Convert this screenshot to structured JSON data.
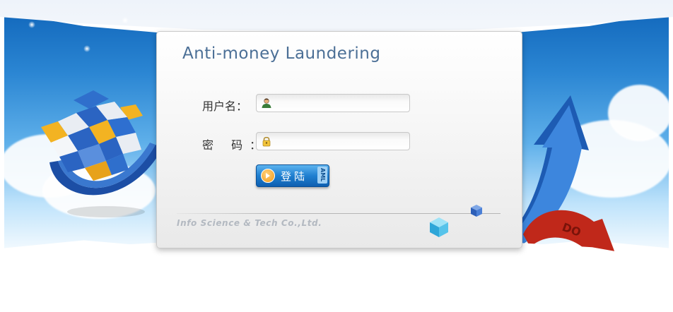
{
  "panel": {
    "title": "Anti-money Laundering",
    "username_label": "用户名",
    "password_label": "密 码",
    "colon": "：",
    "username_value": "",
    "password_value": "",
    "login_button_label": "登陆",
    "login_button_tag": "AML",
    "company": "Info Science & Tech Co.,Ltd."
  },
  "icons": {
    "user_field": "user-icon",
    "password_field": "lock-icon",
    "login": "arrow-right-icon"
  },
  "decoration": {
    "arrow_text": "DO"
  },
  "colors": {
    "title": "#4b6f96",
    "button": "#1f7fd0",
    "arrow_blue": "#1d5bb3",
    "arrow_red": "#c0281a"
  }
}
